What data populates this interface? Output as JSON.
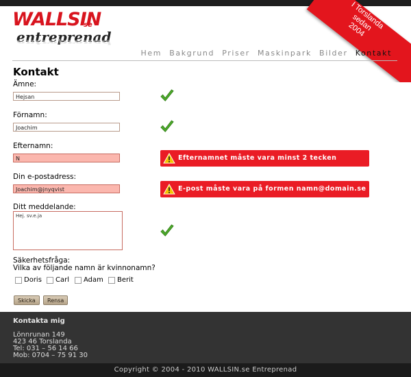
{
  "logo": {
    "brand": "WALLSIN",
    "brand_suffix": "se",
    "subtitle": "entreprenad"
  },
  "ribbon": {
    "line1": "I Torslanda",
    "line2": "sedan",
    "line3": "2004"
  },
  "nav": {
    "items": [
      "Hem",
      "Bakgrund",
      "Priser",
      "Maskinpark",
      "Bilder",
      "Kontakt"
    ],
    "active": "Kontakt"
  },
  "page": {
    "title": "Kontakt"
  },
  "form": {
    "subject": {
      "label": "Ämne:",
      "value": "Hejsan"
    },
    "firstname": {
      "label": "Förnamn:",
      "value": "Joachim"
    },
    "lastname": {
      "label": "Efternamn:",
      "value": "N",
      "error": "Efternamnet måste vara minst 2 tecken"
    },
    "email": {
      "label": "Din e-postadress:",
      "value": "Joachim@jnyqvist",
      "error": "E-post måste vara på formen namn@domain.se"
    },
    "message": {
      "label": "Ditt meddelande:",
      "value": "Hej. sv.e.ja"
    },
    "security": {
      "line1": "Säkerhetsfråga:",
      "line2": "Vilka av följande namn är kvinnonamn?",
      "options": [
        "Doris",
        "Carl",
        "Adam",
        "Berit"
      ]
    },
    "submit_label": "Skicka",
    "reset_label": "Rensa"
  },
  "colors": {
    "accent_red": "#ea1c25",
    "valid_green": "#4ca82a",
    "error_field": "#fbb7ae"
  },
  "footer": {
    "heading": "Kontakta mig",
    "street": "Lönnrunan 149",
    "city": "423 46 Torslanda",
    "phone": "Tel: 031 – 56 14 66",
    "mobile": "Mob: 0704 – 75 91 30",
    "copyright": "Copyright © 2004 - 2010 WALLSIN.se Entreprenad"
  }
}
